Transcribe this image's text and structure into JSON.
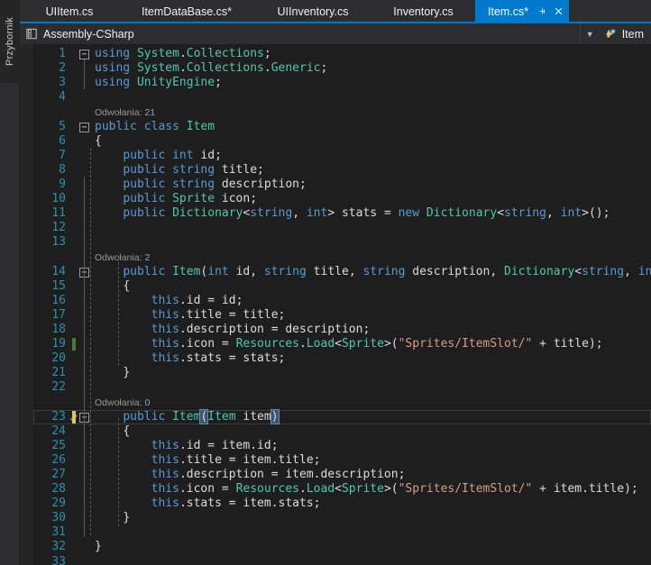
{
  "toolbox": {
    "label": "Przybornik"
  },
  "tabs": [
    {
      "label": "UIItem.cs",
      "active": false,
      "modified": false
    },
    {
      "label": "ItemDataBase.cs*",
      "active": false,
      "modified": true
    },
    {
      "label": "UIInventory.cs",
      "active": false,
      "modified": false
    },
    {
      "label": "Inventory.cs",
      "active": false,
      "modified": false
    },
    {
      "label": "Item.cs*",
      "active": true,
      "modified": true
    }
  ],
  "tab_controls": {
    "pin": "pin-icon",
    "close": "close-icon"
  },
  "navbar": {
    "project": "Assembly-CSharp",
    "project_icon": "project-icon",
    "dropdown_caret": "chevron-down-icon",
    "member": "Item",
    "member_icon": "class-icon"
  },
  "codelens": [
    {
      "line": 5,
      "label": "Odwołania:",
      "count": "21"
    },
    {
      "line": 14,
      "label": "Odwołania:",
      "count": "2"
    },
    {
      "line": 23,
      "label": "Odwołania:",
      "count": "0"
    }
  ],
  "editor": {
    "language": "csharp",
    "current_line": 23,
    "selection": "(Item item)",
    "lines": [
      {
        "n": 1,
        "text": "using System.Collections;"
      },
      {
        "n": 2,
        "text": "using System.Collections.Generic;"
      },
      {
        "n": 3,
        "text": "using UnityEngine;"
      },
      {
        "n": 4,
        "text": ""
      },
      {
        "n": 5,
        "text": "public class Item"
      },
      {
        "n": 6,
        "text": "{"
      },
      {
        "n": 7,
        "text": "    public int id;"
      },
      {
        "n": 8,
        "text": "    public string title;"
      },
      {
        "n": 9,
        "text": "    public string description;"
      },
      {
        "n": 10,
        "text": "    public Sprite icon;"
      },
      {
        "n": 11,
        "text": "    public Dictionary<string, int> stats = new Dictionary<string, int>();"
      },
      {
        "n": 12,
        "text": ""
      },
      {
        "n": 13,
        "text": ""
      },
      {
        "n": 14,
        "text": "    public Item(int id, string title, string description, Dictionary<string, int> stat"
      },
      {
        "n": 15,
        "text": "    {"
      },
      {
        "n": 16,
        "text": "        this.id = id;"
      },
      {
        "n": 17,
        "text": "        this.title = title;"
      },
      {
        "n": 18,
        "text": "        this.description = description;"
      },
      {
        "n": 19,
        "text": "        this.icon = Resources.Load<Sprite>(\"Sprites/ItemSlot/\" + title);"
      },
      {
        "n": 20,
        "text": "        this.stats = stats;"
      },
      {
        "n": 21,
        "text": "    }"
      },
      {
        "n": 22,
        "text": ""
      },
      {
        "n": 23,
        "text": "    public Item(Item item)"
      },
      {
        "n": 24,
        "text": "    {"
      },
      {
        "n": 25,
        "text": "        this.id = item.id;"
      },
      {
        "n": 26,
        "text": "        this.title = item.title;"
      },
      {
        "n": 27,
        "text": "        this.description = item.description;"
      },
      {
        "n": 28,
        "text": "        this.icon = Resources.Load<Sprite>(\"Sprites/ItemSlot/\" + item.title);"
      },
      {
        "n": 29,
        "text": "        this.stats = item.stats;"
      },
      {
        "n": 30,
        "text": "    }"
      },
      {
        "n": 31,
        "text": ""
      },
      {
        "n": 32,
        "text": "}"
      },
      {
        "n": 33,
        "text": ""
      }
    ],
    "change_markers": [
      {
        "line": 19,
        "kind": "added"
      },
      {
        "line": 23,
        "kind": "edited"
      }
    ],
    "quick_actions": [
      {
        "line": 23,
        "icon": "screwdriver-icon"
      }
    ],
    "outline_markers": [
      {
        "line": 1,
        "state": "expanded"
      },
      {
        "line": 5,
        "state": "expanded"
      },
      {
        "line": 14,
        "state": "expanded"
      },
      {
        "line": 23,
        "state": "expanded"
      }
    ]
  },
  "colors": {
    "accent": "#007acc",
    "editor_bg": "#1e1e1e",
    "chrome_bg": "#2d2d30",
    "line_number": "#2b91af",
    "keyword": "#569cd6",
    "type": "#4ec9b0",
    "string": "#d69d85",
    "change_added": "#4b7a34",
    "change_edited": "#d7c94b"
  }
}
